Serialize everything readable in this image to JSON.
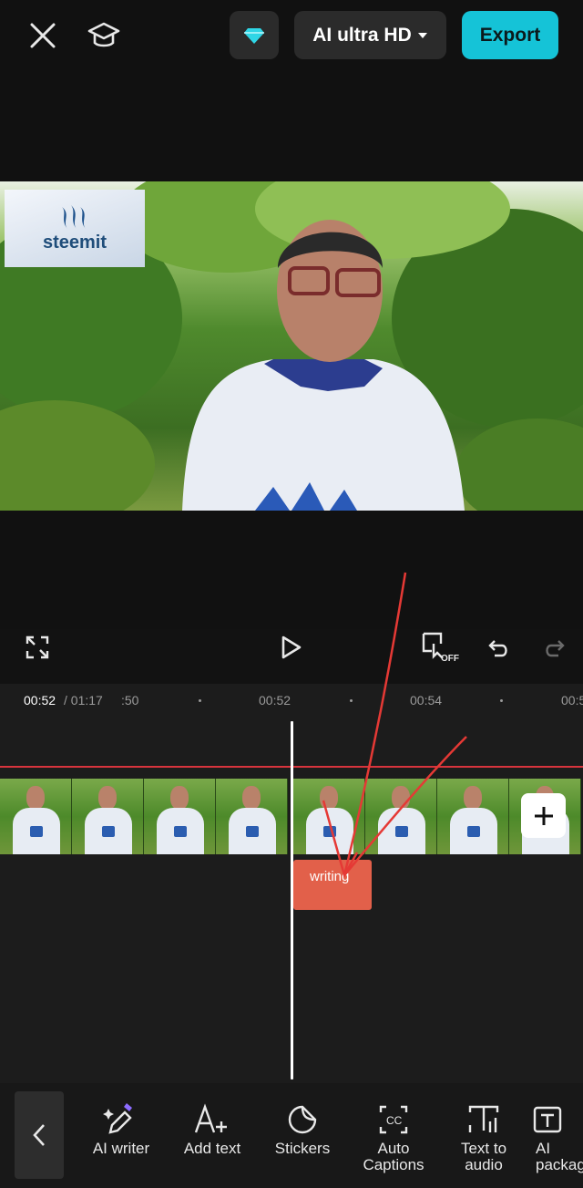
{
  "header": {
    "close_icon": "close-icon",
    "tutorial_icon": "graduation-cap-icon",
    "premium_icon": "diamond-icon",
    "resolution_label": "AI ultra HD",
    "export_label": "Export",
    "accent_color": "#15c3d7"
  },
  "preview": {
    "overlay_logo_text": "steemit"
  },
  "controls": {
    "fullscreen_icon": "fullscreen-icon",
    "play_icon": "play-icon",
    "keyframe_off_label": "OFF",
    "undo_icon": "undo-icon",
    "redo_icon": "redo-icon"
  },
  "timeline": {
    "current_time": "00:52",
    "total_time": "/ 01:17",
    "ticks": [
      ":50",
      "00:52",
      "00:54",
      "00:5"
    ],
    "text_clip_label": "writing",
    "text_clip_color": "#e2604a",
    "add_clip_icon": "plus-icon"
  },
  "toolbar": {
    "back_icon": "chevron-left-icon",
    "items": [
      {
        "label": "AI writer",
        "icon": "ai-pen-icon"
      },
      {
        "label": "Add text",
        "icon": "add-text-icon"
      },
      {
        "label": "Stickers",
        "icon": "sticker-icon"
      },
      {
        "label": "Auto\nCaptions",
        "icon": "captions-icon"
      },
      {
        "label": "Text to\naudio",
        "icon": "text-audio-icon"
      },
      {
        "label": "AI\npackag",
        "icon": "ai-package-icon"
      }
    ]
  }
}
